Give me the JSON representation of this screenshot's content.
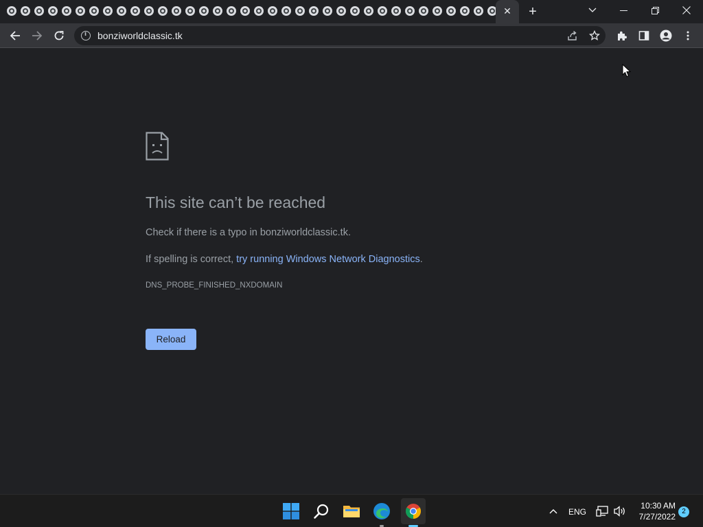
{
  "browser": {
    "tab_count_favicons": 36,
    "tab_close_glyph": "✕",
    "new_tab_glyph": "+",
    "address_bar": {
      "url": "bonziworldclassic.tk"
    }
  },
  "error_page": {
    "headline": "This site can’t be reached",
    "line1": "Check if there is a typo in bonziworldclassic.tk.",
    "line2_prefix": "If spelling is correct, ",
    "line2_link": "try running Windows Network Diagnostics",
    "line2_suffix": ".",
    "error_code": "DNS_PROBE_FINISHED_NXDOMAIN",
    "reload_label": "Reload"
  },
  "taskbar": {
    "language": "ENG",
    "time": "10:30 AM",
    "date": "7/27/2022",
    "notification_count": "2"
  },
  "colors": {
    "page_bg": "#202124",
    "toolbar_bg": "#35363a",
    "text_muted": "#9aa0a6",
    "link": "#8ab4f8",
    "button_bg": "#8ab4f8",
    "taskbar_bg": "#1c1c1c",
    "accent": "#60cdff"
  },
  "icons": {
    "tab_favicon": "chrome-favicon-icon",
    "back": "arrow-left-icon",
    "forward": "arrow-right-icon",
    "reload": "reload-icon",
    "site_info": "info-icon",
    "share": "share-icon",
    "bookmark": "star-icon",
    "extensions": "puzzle-icon",
    "side_panel": "side-panel-icon",
    "profile": "person-icon",
    "menu": "kebab-menu-icon",
    "error": "sad-page-icon",
    "start": "windows-logo-icon",
    "search": "search-icon",
    "explorer": "folder-icon",
    "edge": "edge-icon",
    "chrome": "chrome-icon",
    "tray": "chevron-up-icon",
    "network": "network-icon",
    "volume": "speaker-icon"
  }
}
